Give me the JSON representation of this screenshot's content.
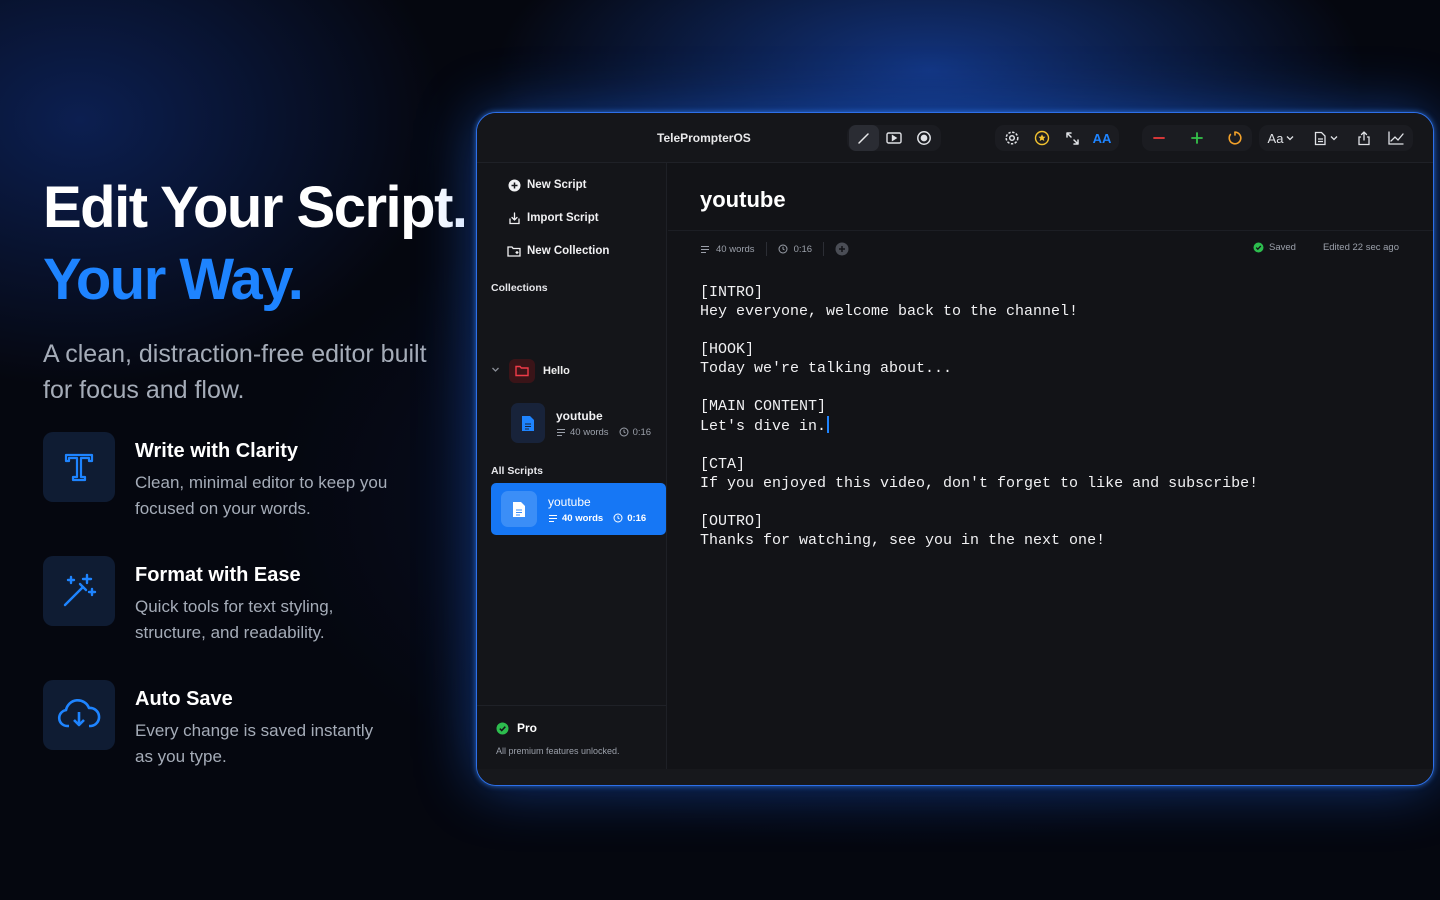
{
  "hero": {
    "title_line1": "Edit Your Script.",
    "title_line2": "Your Way.",
    "subtitle": "A clean, distraction-free editor built for focus and flow."
  },
  "features": [
    {
      "icon": "text-t-icon",
      "title": "Write with Clarity",
      "desc": "Clean, minimal editor to keep you focused on your words."
    },
    {
      "icon": "magic-wand-icon",
      "title": "Format with Ease",
      "desc": "Quick tools for text styling, structure, and readability."
    },
    {
      "icon": "cloud-save-icon",
      "title": "Auto Save",
      "desc": "Every change is saved instantly as you type."
    }
  ],
  "app": {
    "title": "TelePrompterOS",
    "toolbar": {
      "font_label": "Aa",
      "text_size_label": "AA",
      "accent_color": "#1677f5"
    },
    "sidebar": {
      "actions": [
        "New Script",
        "Import Script",
        "New Collection"
      ],
      "collections_heading": "Collections",
      "collection": {
        "name": "Hello"
      },
      "collection_script": {
        "name": "youtube",
        "words": "40 words",
        "duration": "0:16"
      },
      "all_scripts_heading": "All Scripts",
      "active_script": {
        "name": "youtube",
        "words": "40 words",
        "duration": "0:16"
      },
      "pro_label": "Pro",
      "pro_desc": "All premium features unlocked."
    },
    "editor": {
      "title": "youtube",
      "word_count": "40 words",
      "duration": "0:16",
      "status": "Saved",
      "edited": "Edited 22 sec ago",
      "script_blocks": [
        [
          "[INTRO]",
          "Hey everyone, welcome back to the channel!"
        ],
        [
          "[HOOK]",
          "Today we're talking about..."
        ],
        [
          "[MAIN CONTENT]",
          "Let's dive in."
        ],
        [
          "[CTA]",
          "If you enjoyed this video, don't forget to like and subscribe!"
        ],
        [
          "[OUTRO]",
          "Thanks for watching, see you in the next one!"
        ]
      ]
    }
  }
}
